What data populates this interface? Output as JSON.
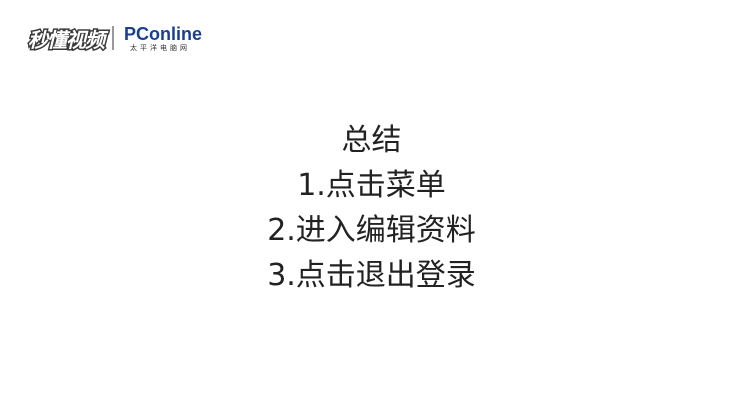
{
  "logos": {
    "miaodong": "秒懂视频",
    "pconline_main": "PConline",
    "pconline_sub": "太平洋电脑网"
  },
  "summary": {
    "title": "总结",
    "steps": [
      "1.点击菜单",
      "2.进入编辑资料",
      "3.点击退出登录"
    ]
  }
}
